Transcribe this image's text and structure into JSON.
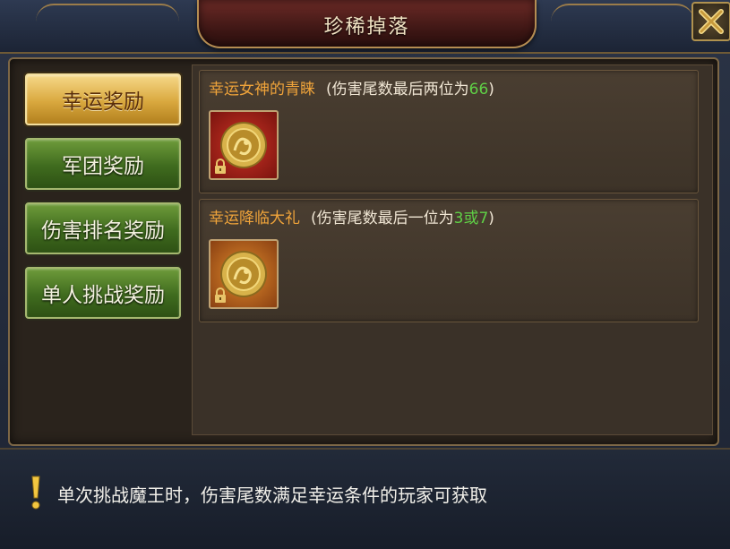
{
  "window": {
    "title": "珍稀掉落"
  },
  "tabs": [
    {
      "label": "幸运奖励",
      "active": true
    },
    {
      "label": "军团奖励",
      "active": false
    },
    {
      "label": "伤害排名奖励",
      "active": false
    },
    {
      "label": "单人挑战奖励",
      "active": false
    }
  ],
  "rewards": [
    {
      "name": "幸运女神的青睐",
      "condition_prefix": "(伤害尾数最后两位为",
      "condition_value": "66",
      "condition_suffix": ")",
      "item_icon": "gold-coin-icon",
      "item_rarity_color": "#c0281e",
      "locked": true
    },
    {
      "name": "幸运降临大礼",
      "condition_prefix": "(伤害尾数最后一位为",
      "condition_value": "3或7",
      "condition_suffix": ")",
      "item_icon": "gold-coin-icon",
      "item_rarity_color": "#d9781f",
      "locked": true
    }
  ],
  "tip": {
    "icon": "exclamation-icon",
    "text": "单次挑战魔王时，伤害尾数满足幸运条件的玩家可获取"
  },
  "colors": {
    "reward_name": "#f0a43a",
    "highlight_value": "#5fd046",
    "active_tab": "#d9a83e",
    "inactive_tab": "#3f6b1e"
  }
}
